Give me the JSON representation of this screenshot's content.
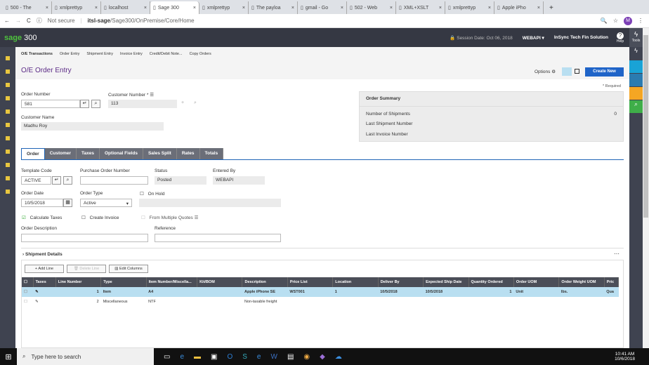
{
  "browser": {
    "tabs": [
      "500 - The",
      "xmlprettyp",
      "localhost",
      "Sage 300",
      "xmlprettyp",
      "The payloa",
      "gmail - Go",
      "502 - Web",
      "XML+XSLT",
      "xmlprettyp",
      "Apple iPho"
    ],
    "active_tab": 3,
    "url_security": "Not secure",
    "url_host": "itsl-sage",
    "url_path": "/Sage300/OnPremise/Core/Home",
    "avatar": "M"
  },
  "header": {
    "logo_sage": "sage",
    "logo_300": "300",
    "session_label": "Session Date:",
    "session_date": "Oct 06, 2018",
    "user": "WEBAPI",
    "company": "InSync Tech Fin Solution",
    "help": "Help",
    "tools": "Tools"
  },
  "breadcrumb": {
    "root": "O/E Transactions",
    "items": [
      "Order Entry",
      "Shipment Entry",
      "Invoice Entry",
      "Credit/Debit Note...",
      "Copy Orders"
    ]
  },
  "page": {
    "title": "O/E Order Entry",
    "options": "Options",
    "create_new": "Create New",
    "required": "* Required"
  },
  "form": {
    "order_number_label": "Order Number",
    "order_number": "581",
    "customer_number_label": "Customer Number *",
    "customer_number": "113",
    "customer_name_label": "Customer Name",
    "customer_name": "Madhu Roy"
  },
  "summary": {
    "title": "Order Summary",
    "shipments_label": "Number of Shipments",
    "shipments": "0",
    "last_shipment_label": "Last Shipment Number",
    "last_invoice_label": "Last Invoice Number"
  },
  "tabs": [
    "Order",
    "Customer",
    "Taxes",
    "Optional Fields",
    "Sales Split",
    "Rates",
    "Totals"
  ],
  "order": {
    "template_code_label": "Template Code",
    "template_code": "ACTIVE",
    "po_label": "Purchase Order Number",
    "status_label": "Status",
    "status": "Posted",
    "entered_by_label": "Entered By",
    "entered_by": "WEBAPI",
    "order_date_label": "Order Date",
    "order_date": "10/5/2018",
    "order_type_label": "Order Type",
    "order_type": "Active",
    "on_hold": "On Hold",
    "calc_taxes": "Calculate Taxes",
    "create_invoice": "Create Invoice",
    "from_quotes": "From Multiple Quotes",
    "description_label": "Order Description",
    "reference_label": "Reference"
  },
  "shipment": {
    "title": "Shipment Details",
    "add_line": "Add Line",
    "delete_line": "Delete Line",
    "edit_columns": "Edit Columns"
  },
  "grid": {
    "columns": [
      "Taxes",
      "Line Number",
      "Type",
      "Item Number/Miscella...",
      "Kit/BOM",
      "Description",
      "Price List",
      "Location",
      "Deliver By",
      "Expected Ship Date",
      "Quantity Ordered",
      "Order UOM",
      "Order Weight UOM",
      "Pric"
    ],
    "rows": [
      [
        "",
        "1",
        "Item",
        "A4",
        "",
        "Apple iPhone SE",
        "WST001",
        "1",
        "10/5/2018",
        "10/5/2018",
        "1",
        "Unit",
        "lbs.",
        "Qua"
      ],
      [
        "",
        "2",
        "Miscellaneous",
        "NTF",
        "",
        "Non-taxable freight",
        "",
        "",
        "",
        "",
        "",
        "",
        "",
        ""
      ]
    ]
  },
  "taskbar": {
    "search": "Type here to search",
    "time": "10:41 AM",
    "date": "10/6/2018"
  }
}
